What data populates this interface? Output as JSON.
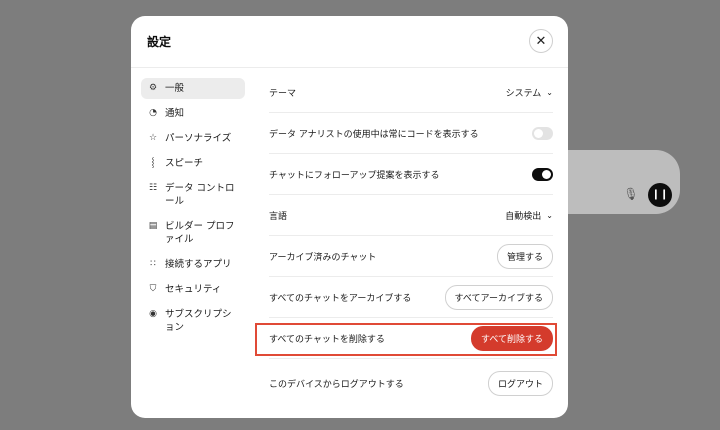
{
  "dialog": {
    "title": "設定",
    "close_icon": "close-icon"
  },
  "sidebar": {
    "items": [
      {
        "label": "一般",
        "icon": "gear-icon",
        "active": true
      },
      {
        "label": "通知",
        "icon": "bell-icon",
        "active": false
      },
      {
        "label": "パーソナライズ",
        "icon": "personalize-icon",
        "active": false
      },
      {
        "label": "スピーチ",
        "icon": "waveform-icon",
        "active": false
      },
      {
        "label": "データ コントロール",
        "icon": "database-icon",
        "active": false
      },
      {
        "label": "ビルダー プロファイル",
        "icon": "profile-card-icon",
        "active": false
      },
      {
        "label": "接続するアプリ",
        "icon": "apps-grid-icon",
        "active": false
      },
      {
        "label": "セキュリティ",
        "icon": "shield-icon",
        "active": false
      },
      {
        "label": "サブスクリプション",
        "icon": "subscription-icon",
        "active": false
      }
    ]
  },
  "settings": {
    "theme_label": "テーマ",
    "theme_value": "システム",
    "code_label": "データ アナリストの使用中は常にコードを表示する",
    "code_enabled": false,
    "followup_label": "チャットにフォローアップ提案を表示する",
    "followup_enabled": true,
    "language_label": "言語",
    "language_value": "自動検出",
    "archived_label": "アーカイブ済みのチャット",
    "archived_button": "管理する",
    "archive_all_label": "すべてのチャットをアーカイブする",
    "archive_all_button": "すべてアーカイブする",
    "delete_all_label": "すべてのチャットを削除する",
    "delete_all_button": "すべて削除する",
    "logout_label": "このデバイスからログアウトする",
    "logout_button": "ログアウト"
  },
  "colors": {
    "overlay": "#7d7d7d",
    "danger": "#d43b2c",
    "highlight": "#e04a36",
    "toggle_on": "#0d0d0d"
  }
}
